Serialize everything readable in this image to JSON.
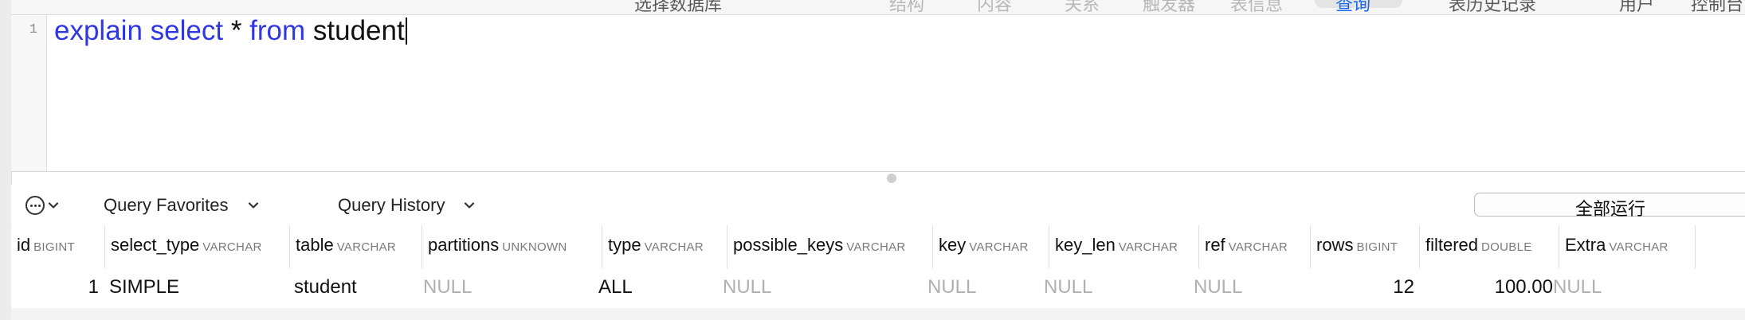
{
  "toolbar": {
    "items": [
      {
        "label": "选择数据库",
        "state": "normal"
      },
      {
        "label": "结构",
        "state": "dim"
      },
      {
        "label": "内容",
        "state": "dim"
      },
      {
        "label": "关系",
        "state": "dim"
      },
      {
        "label": "触发器",
        "state": "dim"
      },
      {
        "label": "表信息",
        "state": "dim"
      },
      {
        "label": "查询",
        "state": "active"
      },
      {
        "label": "表历史记录",
        "state": "normal"
      },
      {
        "label": "用户",
        "state": "normal"
      },
      {
        "label": "控制台",
        "state": "normal"
      }
    ]
  },
  "editor": {
    "line_number": "1",
    "tokens": [
      {
        "text": "explain",
        "kind": "keyword"
      },
      {
        "text": " ",
        "kind": "plain"
      },
      {
        "text": "select",
        "kind": "keyword"
      },
      {
        "text": " * ",
        "kind": "plain"
      },
      {
        "text": "from",
        "kind": "keyword"
      },
      {
        "text": " student",
        "kind": "plain"
      }
    ]
  },
  "query_bar": {
    "more_icon": "ellipsis-circle-icon",
    "favorites_label": "Query Favorites",
    "history_label": "Query History",
    "run_label": "全部运行"
  },
  "results": {
    "columns": [
      {
        "name": "id",
        "type": "BIGINT"
      },
      {
        "name": "select_type",
        "type": "VARCHAR"
      },
      {
        "name": "table",
        "type": "VARCHAR"
      },
      {
        "name": "partitions",
        "type": "UNKNOWN"
      },
      {
        "name": "type",
        "type": "VARCHAR"
      },
      {
        "name": "possible_keys",
        "type": "VARCHAR"
      },
      {
        "name": "key",
        "type": "VARCHAR"
      },
      {
        "name": "key_len",
        "type": "VARCHAR"
      },
      {
        "name": "ref",
        "type": "VARCHAR"
      },
      {
        "name": "rows",
        "type": "BIGINT"
      },
      {
        "name": "filtered",
        "type": "DOUBLE"
      },
      {
        "name": "Extra",
        "type": "VARCHAR"
      }
    ],
    "rows": [
      [
        "1",
        "SIMPLE",
        "student",
        "NULL",
        "ALL",
        "NULL",
        "NULL",
        "NULL",
        "NULL",
        "12",
        "100.00",
        "NULL"
      ]
    ]
  },
  "colors": {
    "keyword": "#2f36e3",
    "null_text": "#b0b0b0",
    "active_tab": "#1a6af1"
  }
}
